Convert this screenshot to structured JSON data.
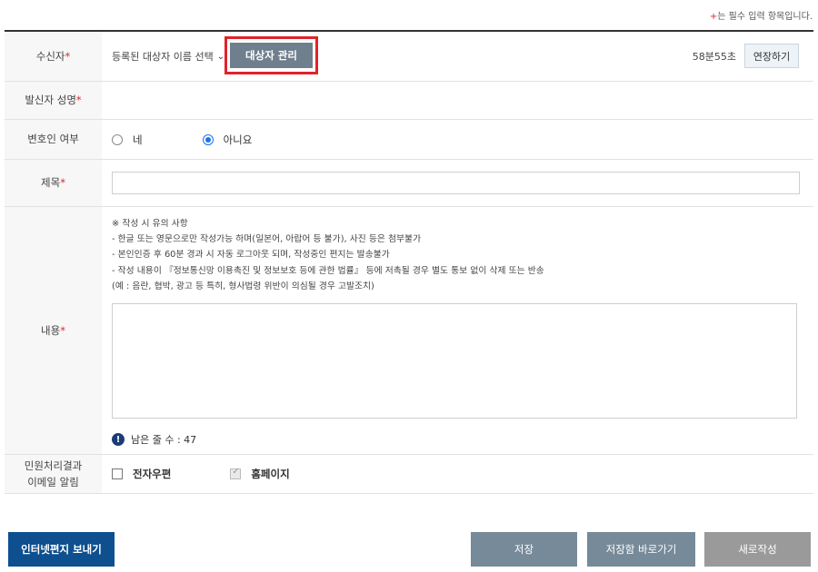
{
  "required_note": {
    "star": "+",
    "text": "는 필수 입력 항목입니다."
  },
  "rows": {
    "recipient": {
      "label": "수신자",
      "select_value": "등록된 대상자 이름 선택",
      "manage_button": "대상자 관리",
      "timer": "58분55초",
      "extend_button": "연장하기"
    },
    "sender": {
      "label": "발신자 성명"
    },
    "lawyer": {
      "label": "변호인 여부",
      "option_yes": "네",
      "option_no": "아니요",
      "selected": "아니요"
    },
    "title": {
      "label": "제목",
      "value": ""
    },
    "content": {
      "label": "내용",
      "notes": [
        "※ 작성 시 유의 사항",
        "- 한글 또는 영문으로만 작성가능 하며(일본어, 아랍어 등 불가), 사진 등은 첨부불가",
        "- 본인인증 후 60분 경과 시 자동 로그아웃 되며, 작성중인 편지는 발송불가",
        "- 작성 내용이 『정보통신망 이용촉진 및 정보보호 등에 관한 법률』 등에 저촉될 경우 별도 통보 없이 삭제 또는 반송",
        "(예 : 음란, 협박, 광고 등 특히, 형사법령 위반이 의심될 경우 고발조치)"
      ],
      "value": "",
      "remaining_label": "남은 줄 수 : 47"
    },
    "notify": {
      "label_line1": "민원처리결과",
      "label_line2": "이메일 알림",
      "option_post": "전자우편",
      "option_homepage": "홈페이지"
    }
  },
  "buttons": {
    "send": "인터넷편지 보내기",
    "save": "저장",
    "save_goto": "저장함 바로가기",
    "new": "새로작성"
  },
  "colors": {
    "accent": "#0d4f8f",
    "required": "#d9262e",
    "highlight": "#e1232a"
  }
}
